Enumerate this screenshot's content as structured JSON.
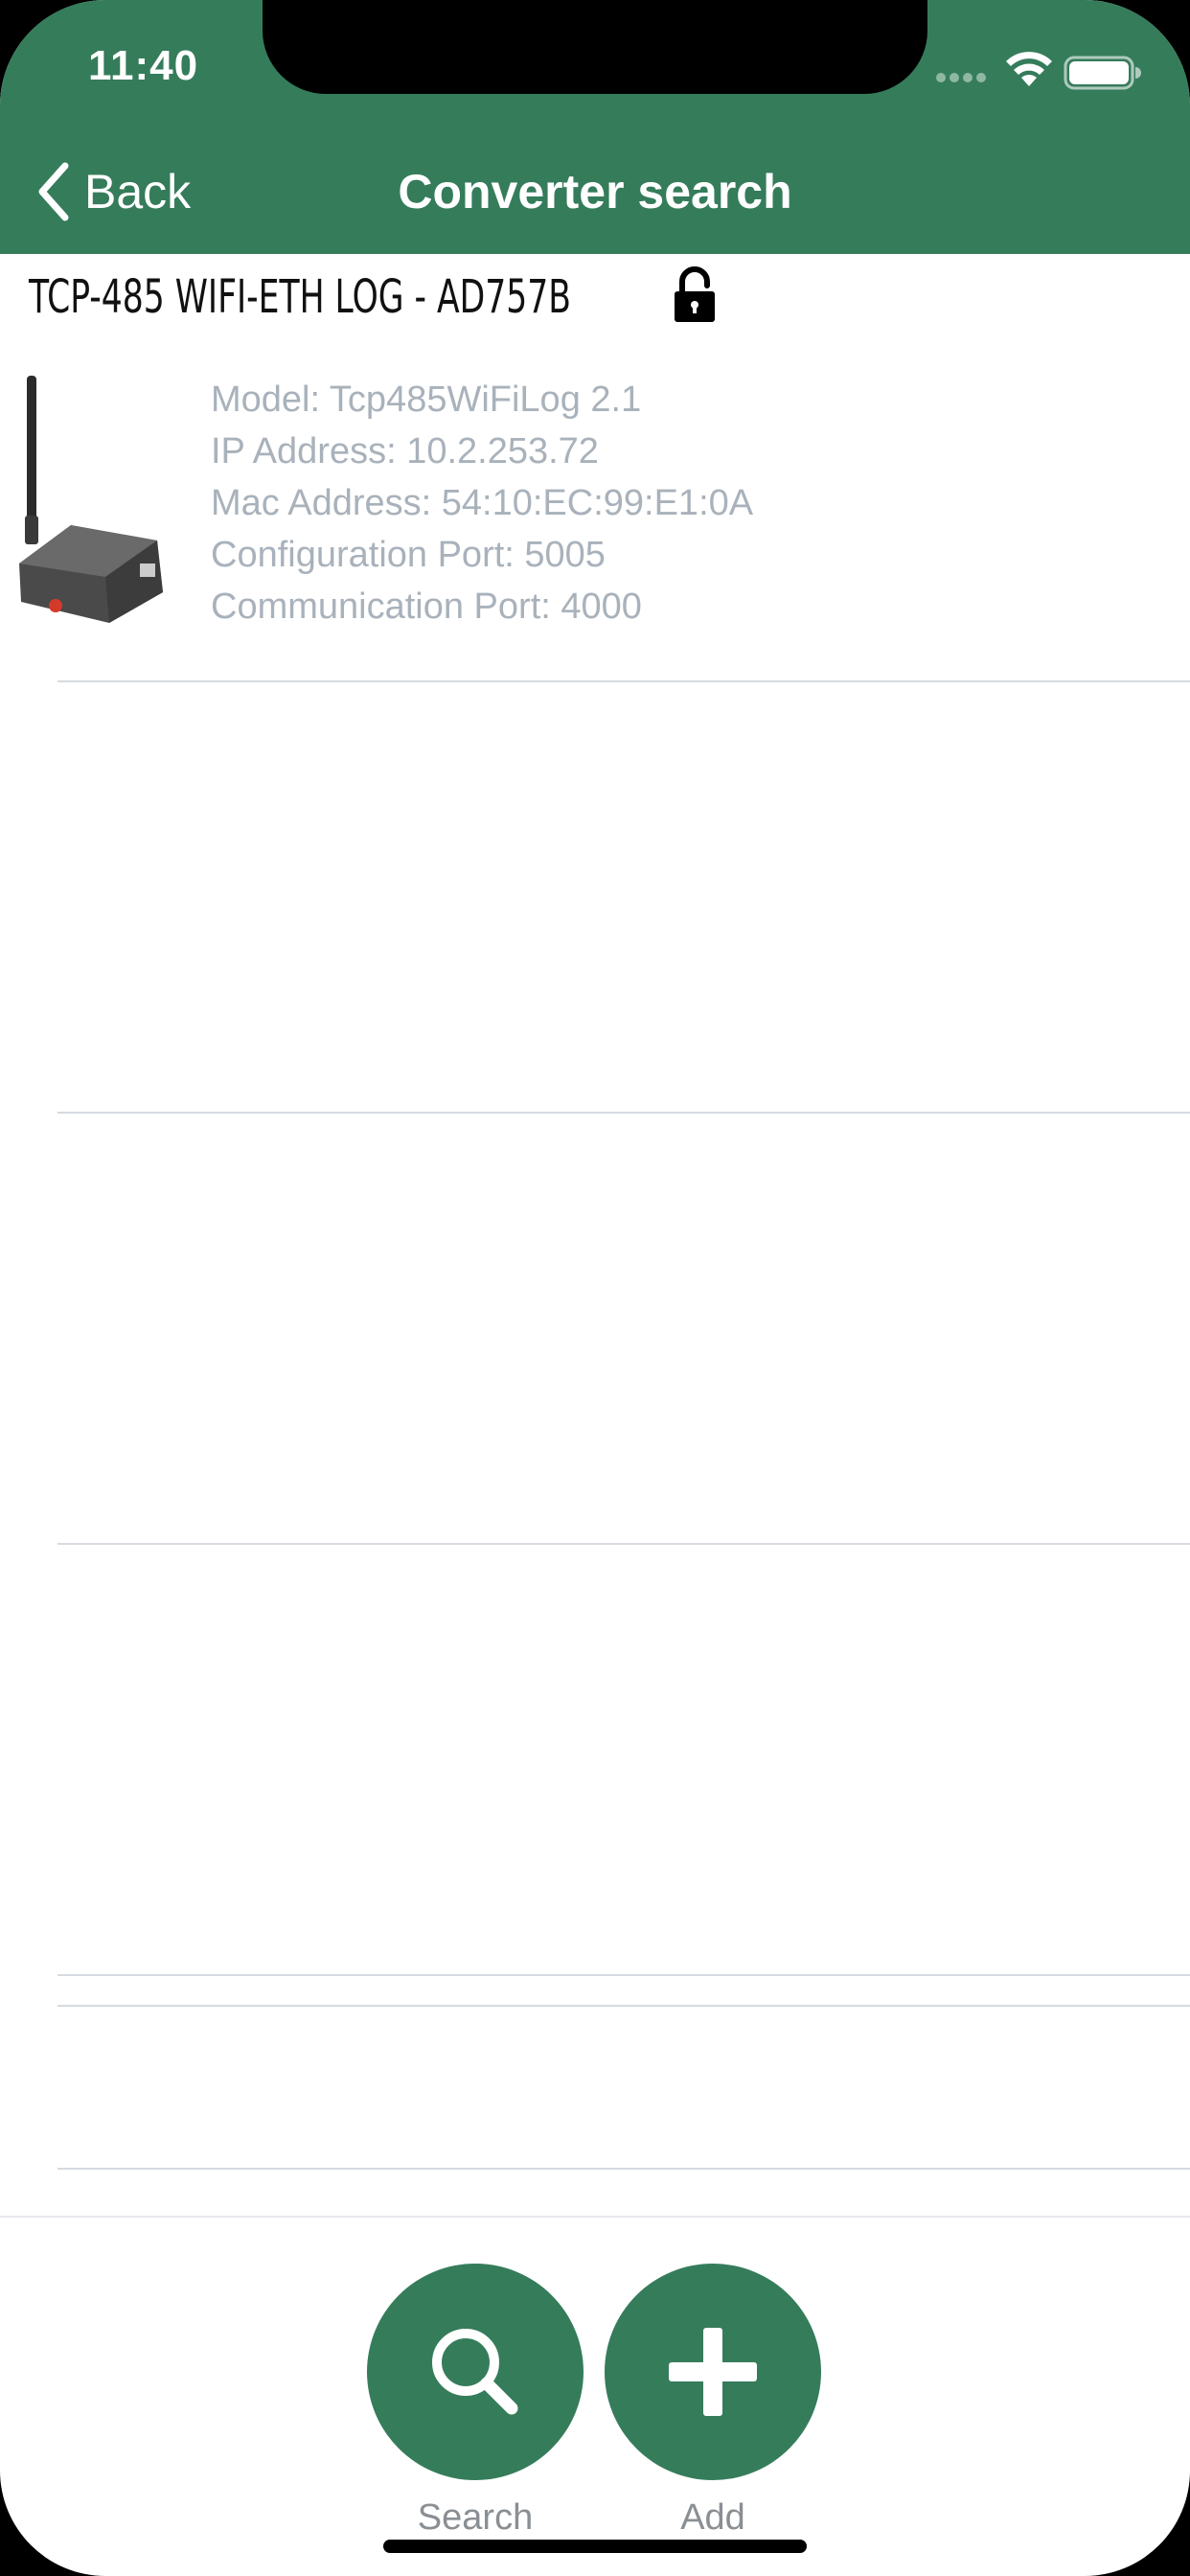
{
  "status_bar": {
    "time": "11:40"
  },
  "nav": {
    "back_label": "Back",
    "title": "Converter search"
  },
  "device": {
    "title": "TCP-485 WIFI-ETH LOG - AD757B",
    "details": [
      "Model: Tcp485WiFiLog 2.1",
      "IP Address: 10.2.253.72",
      "Mac Address: 54:10:EC:99:E1:0A",
      "Configuration Port: 5005",
      "Communication Port: 4000"
    ]
  },
  "toolbar": {
    "search_label": "Search",
    "add_label": "Add"
  },
  "colors": {
    "accent": "#357c5b",
    "detail_text": "#a9b2bb"
  },
  "icons": [
    "back-chevron-icon",
    "lock-icon",
    "search-icon",
    "plus-icon",
    "wifi-icon",
    "battery-icon",
    "signal-icon"
  ]
}
